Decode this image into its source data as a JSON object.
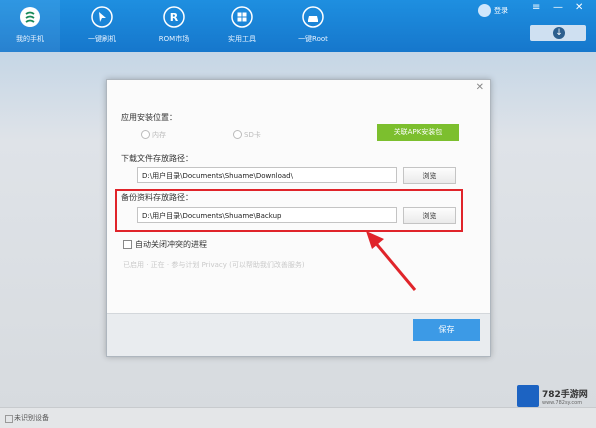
{
  "toolbar": {
    "items": [
      {
        "label": "我的手机",
        "icon": "s-logo-icon"
      },
      {
        "label": "一键刷机",
        "icon": "cursor-icon"
      },
      {
        "label": "ROM市场",
        "icon": "r-icon"
      },
      {
        "label": "实用工具",
        "icon": "grid-icon"
      },
      {
        "label": "一键Root",
        "icon": "car-icon"
      }
    ],
    "login_label": "登录"
  },
  "dialog": {
    "install_location_label": "应用安装位置：",
    "radio_options": [
      "内存",
      "SD卡"
    ],
    "apk_button_label": "关联APK安装包",
    "download_path_label": "下载文件存放路径：",
    "download_path_value": "D:\\用户目录\\Documents\\Shuame\\Download\\",
    "browse_label": "浏览",
    "backup_path_label": "备份资料存放路径：",
    "backup_path_value": "D:\\用户目录\\Documents\\Shuame\\Backup",
    "auto_close_label": "自动关闭冲突的进程",
    "faded_option_text": "已启用  ·  正在  ·  参与计划 Privacy (可以帮助我们改善服务)",
    "save_label": "保存"
  },
  "status": {
    "device_text": "未识别设备"
  },
  "watermark": {
    "brand": "782手游网",
    "url": "www.782sy.com"
  },
  "colors": {
    "toolbar_blue": "#1677cc",
    "apk_green": "#7cbf2e",
    "save_blue": "#3c9ae6",
    "highlight_red": "#e0242a"
  }
}
